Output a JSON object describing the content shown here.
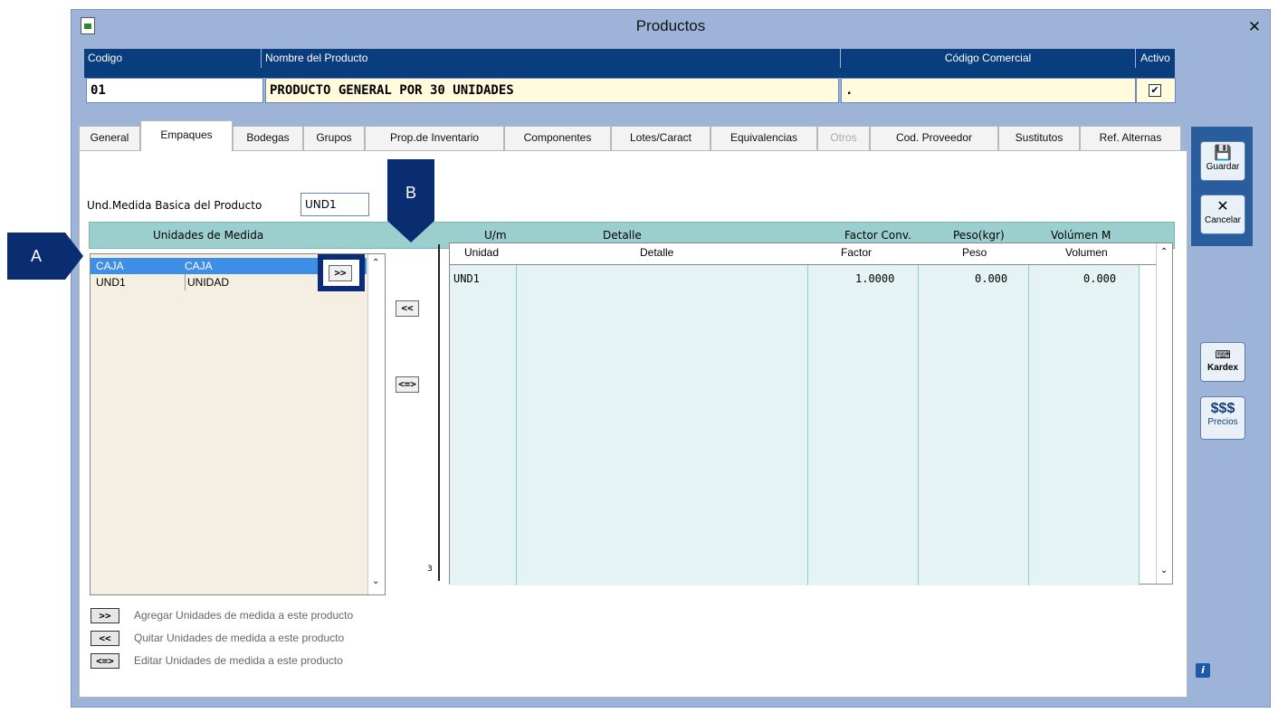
{
  "window": {
    "title": "Productos"
  },
  "header": {
    "columns": [
      "Codigo",
      "Nombre del Producto",
      "Código Comercial",
      "Activo"
    ],
    "codigo": "01",
    "nombre": "PRODUCTO GENERAL POR 30 UNIDADES",
    "codigo_comercial": ".",
    "activo_checked": "✔"
  },
  "tabs": [
    {
      "label": "General"
    },
    {
      "label": "Empaques"
    },
    {
      "label": "Bodegas"
    },
    {
      "label": "Grupos"
    },
    {
      "label": "Prop.de Inventario"
    },
    {
      "label": "Componentes"
    },
    {
      "label": "Lotes/Caract"
    },
    {
      "label": "Equivalencias"
    },
    {
      "label": "Otros"
    },
    {
      "label": "Cod. Proveedor"
    },
    {
      "label": "Sustitutos"
    },
    {
      "label": "Ref. Alternas"
    }
  ],
  "active_tab": "Empaques",
  "und_basica": {
    "label": "Und.Medida Basica del Producto",
    "value": "UND1"
  },
  "teal_header": {
    "unidades": "Unidades  de  Medida",
    "um": "U/m",
    "detalle": "Detalle",
    "factor": "Factor Conv.",
    "peso": "Peso(kgr)",
    "volumen": "Volúmen M"
  },
  "left_list": [
    {
      "code": "CAJA",
      "name": "CAJA"
    },
    {
      "code": "UND1",
      "name": "UNIDAD"
    }
  ],
  "buttons": {
    "add": ">>",
    "remove": "<<",
    "edit": "<=>"
  },
  "ruler_count": "3",
  "grid": {
    "headers": [
      "Unidad",
      "Detalle",
      "Factor",
      "Peso",
      "Volumen"
    ],
    "rows": [
      {
        "unidad": "UND1",
        "detalle": "",
        "factor": "1.0000",
        "peso": "0.000",
        "volumen": "0.000"
      }
    ]
  },
  "legend": [
    {
      "btn": ">>",
      "text": "Agregar Unidades de medida a este producto"
    },
    {
      "btn": "<<",
      "text": "Quitar Unidades de medida a este producto"
    },
    {
      "btn": "<=>",
      "text": "Editar  Unidades de medida a este producto"
    }
  ],
  "side": {
    "guardar": "Guardar",
    "cancelar": "Cancelar",
    "kardex": "Kardex",
    "precios_symbol": "$$$",
    "precios": "Precios"
  },
  "callouts": {
    "a": "A",
    "b": "B"
  }
}
